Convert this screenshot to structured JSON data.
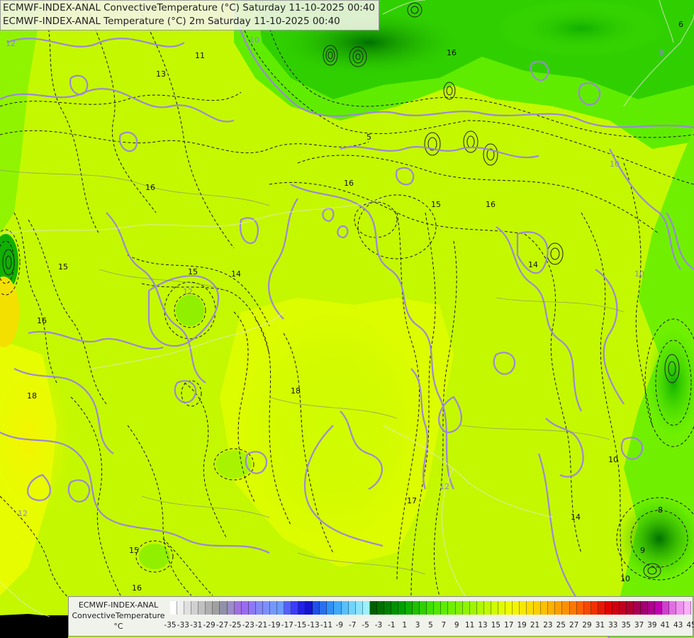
{
  "title": {
    "line1": "ECMWF-INDEX-ANAL ConvectiveTemperature (°C) Saturday 11-10-2025 00:40",
    "line2": "ECMWF-INDEX-ANAL Temperature (°C) 2m Saturday 11-10-2025 00:40"
  },
  "legend": {
    "title_line1": "ECMWF-INDEX-ANAL",
    "title_line2": "ConvectiveTemperature",
    "unit": "°C",
    "tick_labels": [
      "-35",
      "-33",
      "-31",
      "-29",
      "-27",
      "-25",
      "-23",
      "-21",
      "-19",
      "-17",
      "-15",
      "-13",
      "-11",
      "-9",
      "-7",
      "-5",
      "-3",
      "-1",
      "1",
      "3",
      "5",
      "7",
      "9",
      "11",
      "13",
      "15",
      "17",
      "19",
      "21",
      "23",
      "25",
      "27",
      "29",
      "31",
      "33",
      "35",
      "37",
      "39",
      "41",
      "43",
      "45"
    ],
    "colors": [
      "#ffffff",
      "#f0f0f0",
      "#e0e0e0",
      "#d0d0d0",
      "#c0c0c0",
      "#b0b0b0",
      "#a0a0a0",
      "#9090a8",
      "#9c8cc8",
      "#a070e0",
      "#9a6cf0",
      "#8c78f4",
      "#8488f8",
      "#7c90fc",
      "#7498fc",
      "#6c9cfc",
      "#5460fc",
      "#3c3cf8",
      "#2020e8",
      "#1414d0",
      "#1e50e8",
      "#2870f0",
      "#3090f4",
      "#40a8f8",
      "#58c0fc",
      "#70d4fc",
      "#88e4fc",
      "#9cf0fc",
      "#006000",
      "#007000",
      "#008000",
      "#009000",
      "#00a000",
      "#10b000",
      "#20c000",
      "#30d000",
      "#40e000",
      "#50e800",
      "#60ec00",
      "#70f000",
      "#80f000",
      "#90f400",
      "#a0f400",
      "#b0f800",
      "#c0f800",
      "#d0fc00",
      "#e0fc00",
      "#eefc00",
      "#f4f400",
      "#f8e800",
      "#fadc00",
      "#fcd000",
      "#fcc000",
      "#fcb000",
      "#fca000",
      "#fc9000",
      "#fc7800",
      "#fc6000",
      "#f84800",
      "#f03000",
      "#e81800",
      "#e00000",
      "#d00010",
      "#c00020",
      "#b00030",
      "#a80050",
      "#a00070",
      "#b00090",
      "#c000b0",
      "#d040d0",
      "#e070e0",
      "#f090f0",
      "#f8b0f8"
    ]
  },
  "map": {
    "contour_labels": [
      {
        "text": "11"
      },
      {
        "text": "13"
      },
      {
        "text": "16"
      },
      {
        "text": "15"
      },
      {
        "text": "14"
      },
      {
        "text": "15"
      },
      {
        "text": "16"
      },
      {
        "text": "18"
      },
      {
        "text": "15"
      },
      {
        "text": "16"
      },
      {
        "text": "16"
      },
      {
        "text": "15"
      },
      {
        "text": "16"
      },
      {
        "text": "14"
      },
      {
        "text": "17"
      },
      {
        "text": "14"
      },
      {
        "text": "9"
      },
      {
        "text": "8"
      },
      {
        "text": "10"
      },
      {
        "text": "6"
      },
      {
        "text": "18"
      },
      {
        "text": "5"
      },
      {
        "text": "16"
      },
      {
        "text": "10"
      }
    ],
    "isotherm_labels": [
      {
        "text": "12"
      },
      {
        "text": "12"
      },
      {
        "text": "10"
      },
      {
        "text": "12"
      },
      {
        "text": "10"
      },
      {
        "text": "10"
      },
      {
        "text": "8"
      },
      {
        "text": "12"
      }
    ]
  }
}
